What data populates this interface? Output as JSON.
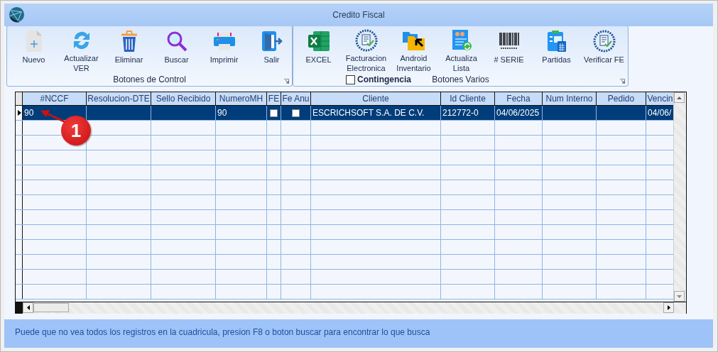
{
  "window": {
    "title": "Credito Fiscal"
  },
  "ribbon": {
    "groups": [
      {
        "label": "Botones de Control",
        "buttons": [
          {
            "label": "Nuevo"
          },
          {
            "label": "Actualizar\nVER"
          },
          {
            "label": "Eliminar"
          },
          {
            "label": "Buscar"
          },
          {
            "label": "Imprimir"
          },
          {
            "label": "Salir"
          }
        ]
      },
      {
        "label": "Botones Varios",
        "buttons": [
          {
            "label": "EXCEL"
          },
          {
            "label": "Facturacion\nElectronica"
          },
          {
            "label": "Android\nInventario"
          },
          {
            "label": "Actualiza\nLista"
          },
          {
            "label": "# SERIE"
          },
          {
            "label": "Partidas"
          },
          {
            "label": "Verificar FE"
          }
        ],
        "checkbox": {
          "label": "Contingencia",
          "checked": false
        }
      }
    ]
  },
  "table": {
    "columns": [
      {
        "label": "#NCCF",
        "kind": "text"
      },
      {
        "label": "Resolucion-DTE",
        "kind": "text"
      },
      {
        "label": "Sello Recibido",
        "kind": "text"
      },
      {
        "label": "NumeroMH",
        "kind": "text"
      },
      {
        "label": "FE",
        "kind": "check"
      },
      {
        "label": "Fe Anu",
        "kind": "check"
      },
      {
        "label": "Cliente",
        "kind": "text"
      },
      {
        "label": "Id Cliente",
        "kind": "text"
      },
      {
        "label": "Fecha",
        "kind": "text"
      },
      {
        "label": "Num Interno",
        "kind": "text"
      },
      {
        "label": "Pedido",
        "kind": "text"
      },
      {
        "label": "Vencin",
        "kind": "text"
      }
    ],
    "rows": [
      {
        "selected": true,
        "cells": [
          "90",
          null,
          null,
          "90",
          {
            "checked": false
          },
          {
            "checked": false
          },
          "ESCRICHSOFT S.A. DE C.V.",
          "212772-0",
          "04/06/2025",
          null,
          null,
          "04/06/"
        ]
      }
    ]
  },
  "annotation": {
    "label": "1"
  },
  "status_text": "Puede que no vea todos los registros en la cuadricula, presion F8 o boton buscar para encontrar lo que busca"
}
